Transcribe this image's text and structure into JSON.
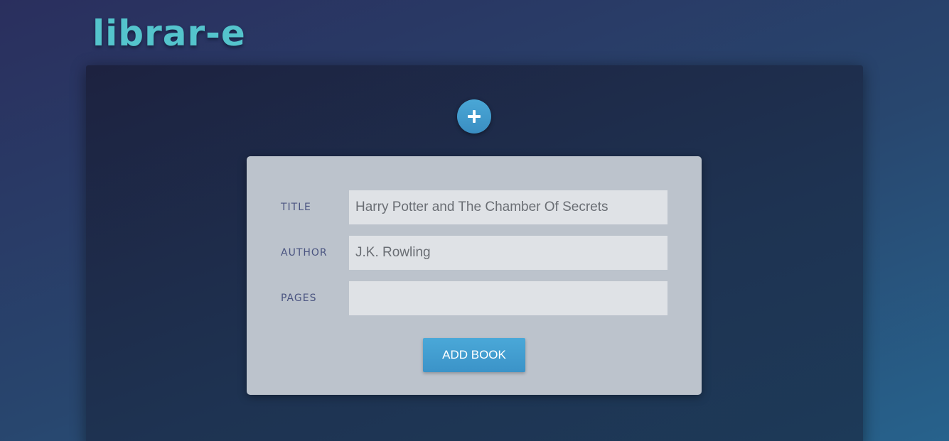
{
  "app": {
    "logo_text": "librar-e"
  },
  "toolbar": {
    "add_toggle_icon": "plus-icon",
    "add_toggle_color": "#429ccd"
  },
  "form": {
    "fields": [
      {
        "label": "TITLE",
        "value": "Harry Potter and The Chamber Of Secrets",
        "placeholder": ""
      },
      {
        "label": "AUTHOR",
        "value": "J.K. Rowling",
        "placeholder": ""
      },
      {
        "label": "PAGES",
        "value": "",
        "placeholder": ""
      }
    ],
    "submit_label": "ADD BOOK"
  },
  "colors": {
    "accent": "#429ccd",
    "logo": "#54c4cc",
    "card_background": "#bcc3cc",
    "label_text": "#4a5480"
  }
}
